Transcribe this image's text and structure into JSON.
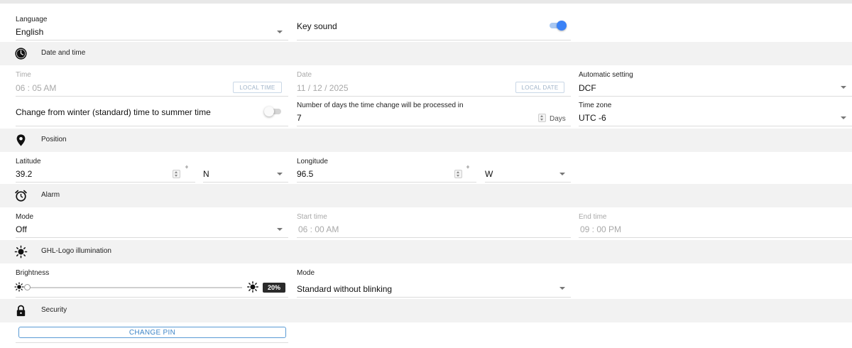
{
  "general": {
    "language": {
      "label": "Language",
      "value": "English"
    },
    "key_sound": {
      "label": "Key sound",
      "enabled": true
    }
  },
  "date_time": {
    "title": "Date and time",
    "icon": "clock-icon",
    "time": {
      "label": "Time",
      "value": "06 : 05  AM",
      "button": "LOCAL TIME"
    },
    "date": {
      "label": "Date",
      "value": "11 / 12 / 2025",
      "button": "LOCAL DATE"
    },
    "automatic": {
      "label": "Automatic setting",
      "value": "DCF"
    },
    "dst": {
      "label": "Change from winter (standard) time to summer time",
      "enabled": false
    },
    "days": {
      "label": "Number of days the time change will be processed in",
      "value": "7",
      "unit": "Days"
    },
    "timezone": {
      "label": "Time zone",
      "value": "UTC -6"
    }
  },
  "position": {
    "title": "Position",
    "icon": "location-pin-icon",
    "latitude": {
      "label": "Latitude",
      "value": "39.2",
      "degree": "°",
      "hemisphere": "N"
    },
    "longitude": {
      "label": "Longitude",
      "value": "96.5",
      "degree": "°",
      "hemisphere": "W"
    }
  },
  "alarm": {
    "title": "Alarm",
    "icon": "alarm-clock-icon",
    "mode": {
      "label": "Mode",
      "value": "Off"
    },
    "start": {
      "label": "Start time",
      "value": "06 : 00  AM"
    },
    "end": {
      "label": "End time",
      "value": "09 : 00  PM"
    }
  },
  "logo": {
    "title": "GHL-Logo illumination",
    "icon": "sun-icon",
    "brightness": {
      "label": "Brightness",
      "value_text": "20%",
      "level": 0.0
    },
    "mode": {
      "label": "Mode",
      "value": "Standard without blinking"
    }
  },
  "security": {
    "title": "Security",
    "icon": "lock-icon",
    "change_pin": "CHANGE PIN"
  },
  "colors": {
    "accent": "#3b82f6",
    "section_bg": "#f2f2f2",
    "disabled_text": "#a9a9a9"
  }
}
